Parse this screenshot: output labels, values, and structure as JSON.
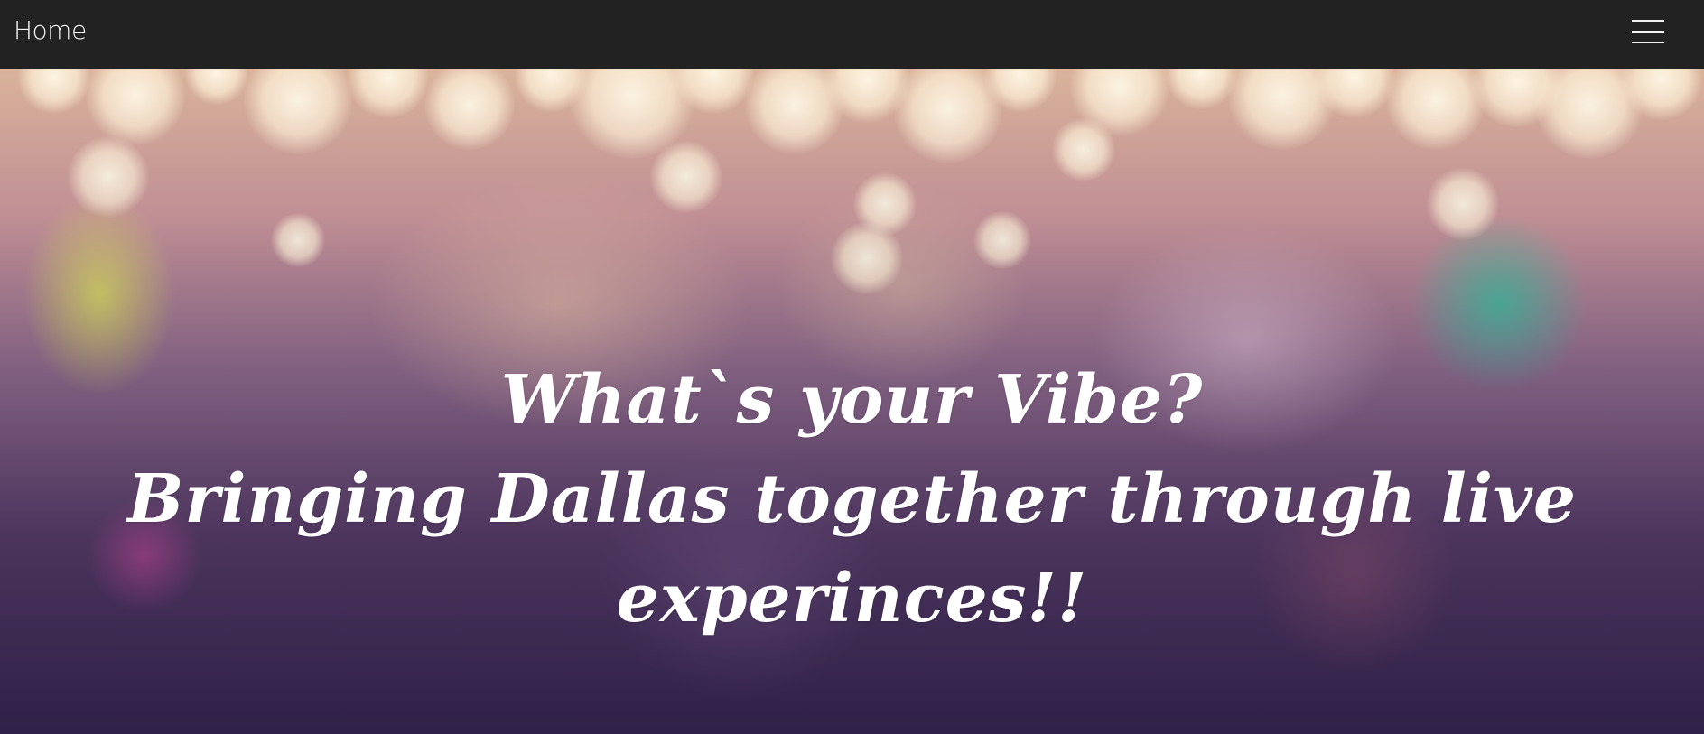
{
  "navbar": {
    "brand_label": "Home",
    "menu_icon": "hamburger-menu-icon"
  },
  "hero": {
    "headline": "What`s your Vibe?",
    "tagline": "Bringing Dallas together through live experinces!!",
    "background": "blurred-crowd-bokeh-lights"
  },
  "colors": {
    "navbar_bg": "#222222",
    "navbar_text": "#f4f4f4",
    "hero_text": "#ffffff"
  }
}
